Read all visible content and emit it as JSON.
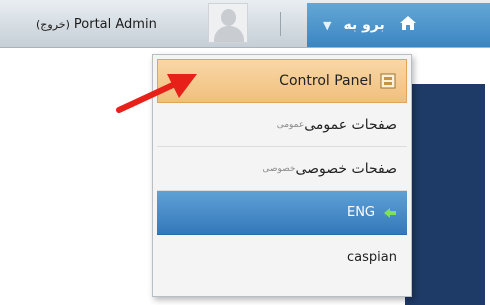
{
  "topbar": {
    "user_name": "Portal Admin",
    "logout_label": "(خروج)",
    "goto_label": "برو به",
    "goto_caret": "▼"
  },
  "dropdown": {
    "items": [
      {
        "label": "Control Panel"
      },
      {
        "label": "صفحات عمومی",
        "sub_label": "عمومی"
      },
      {
        "label": "صفحات خصوصی",
        "sub_label": "خصوصی"
      },
      {
        "label": "ENG"
      },
      {
        "label": "caspian"
      }
    ]
  },
  "icons": {
    "home": "home-icon",
    "control_panel": "control-panel-icon",
    "language_arrow": "arrow-left-icon",
    "annotation": "red-arrow-icon"
  },
  "colors": {
    "goto_blue": "#3a86c2",
    "active_orange": "#f1bf7c",
    "highlight_blue": "#3478bb",
    "annotation_red": "#e8201a",
    "page_dark_blue": "#1e3a66"
  }
}
